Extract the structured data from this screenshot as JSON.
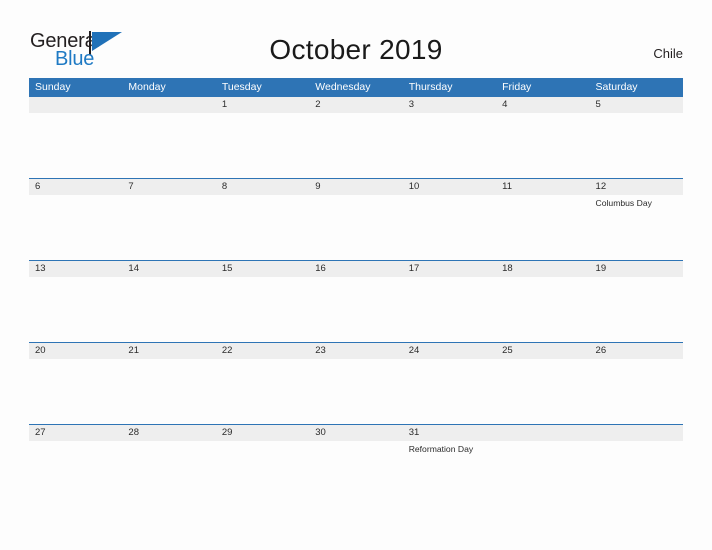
{
  "brand": {
    "name_part1": "General",
    "name_part2": "Blue",
    "flag_icon": "flag-triangle-icon"
  },
  "header": {
    "title": "October 2019",
    "country": "Chile"
  },
  "calendar": {
    "weekday_headers": [
      "Sunday",
      "Monday",
      "Tuesday",
      "Wednesday",
      "Thursday",
      "Friday",
      "Saturday"
    ],
    "colors": {
      "header_blue": "#2e74b5",
      "row_band_gray": "#eeeeee",
      "page_background": "#fdfdfd",
      "text_dark": "#2b2b2b",
      "logo_blue": "#1f7ac4"
    },
    "weeks": [
      {
        "days": [
          {
            "number": "",
            "event": ""
          },
          {
            "number": "",
            "event": ""
          },
          {
            "number": "1",
            "event": ""
          },
          {
            "number": "2",
            "event": ""
          },
          {
            "number": "3",
            "event": ""
          },
          {
            "number": "4",
            "event": ""
          },
          {
            "number": "5",
            "event": ""
          }
        ]
      },
      {
        "days": [
          {
            "number": "6",
            "event": ""
          },
          {
            "number": "7",
            "event": ""
          },
          {
            "number": "8",
            "event": ""
          },
          {
            "number": "9",
            "event": ""
          },
          {
            "number": "10",
            "event": ""
          },
          {
            "number": "11",
            "event": ""
          },
          {
            "number": "12",
            "event": "Columbus Day"
          }
        ]
      },
      {
        "days": [
          {
            "number": "13",
            "event": ""
          },
          {
            "number": "14",
            "event": ""
          },
          {
            "number": "15",
            "event": ""
          },
          {
            "number": "16",
            "event": ""
          },
          {
            "number": "17",
            "event": ""
          },
          {
            "number": "18",
            "event": ""
          },
          {
            "number": "19",
            "event": ""
          }
        ]
      },
      {
        "days": [
          {
            "number": "20",
            "event": ""
          },
          {
            "number": "21",
            "event": ""
          },
          {
            "number": "22",
            "event": ""
          },
          {
            "number": "23",
            "event": ""
          },
          {
            "number": "24",
            "event": ""
          },
          {
            "number": "25",
            "event": ""
          },
          {
            "number": "26",
            "event": ""
          }
        ]
      },
      {
        "days": [
          {
            "number": "27",
            "event": ""
          },
          {
            "number": "28",
            "event": ""
          },
          {
            "number": "29",
            "event": ""
          },
          {
            "number": "30",
            "event": ""
          },
          {
            "number": "31",
            "event": "Reformation Day"
          },
          {
            "number": "",
            "event": ""
          },
          {
            "number": "",
            "event": ""
          }
        ]
      }
    ]
  }
}
